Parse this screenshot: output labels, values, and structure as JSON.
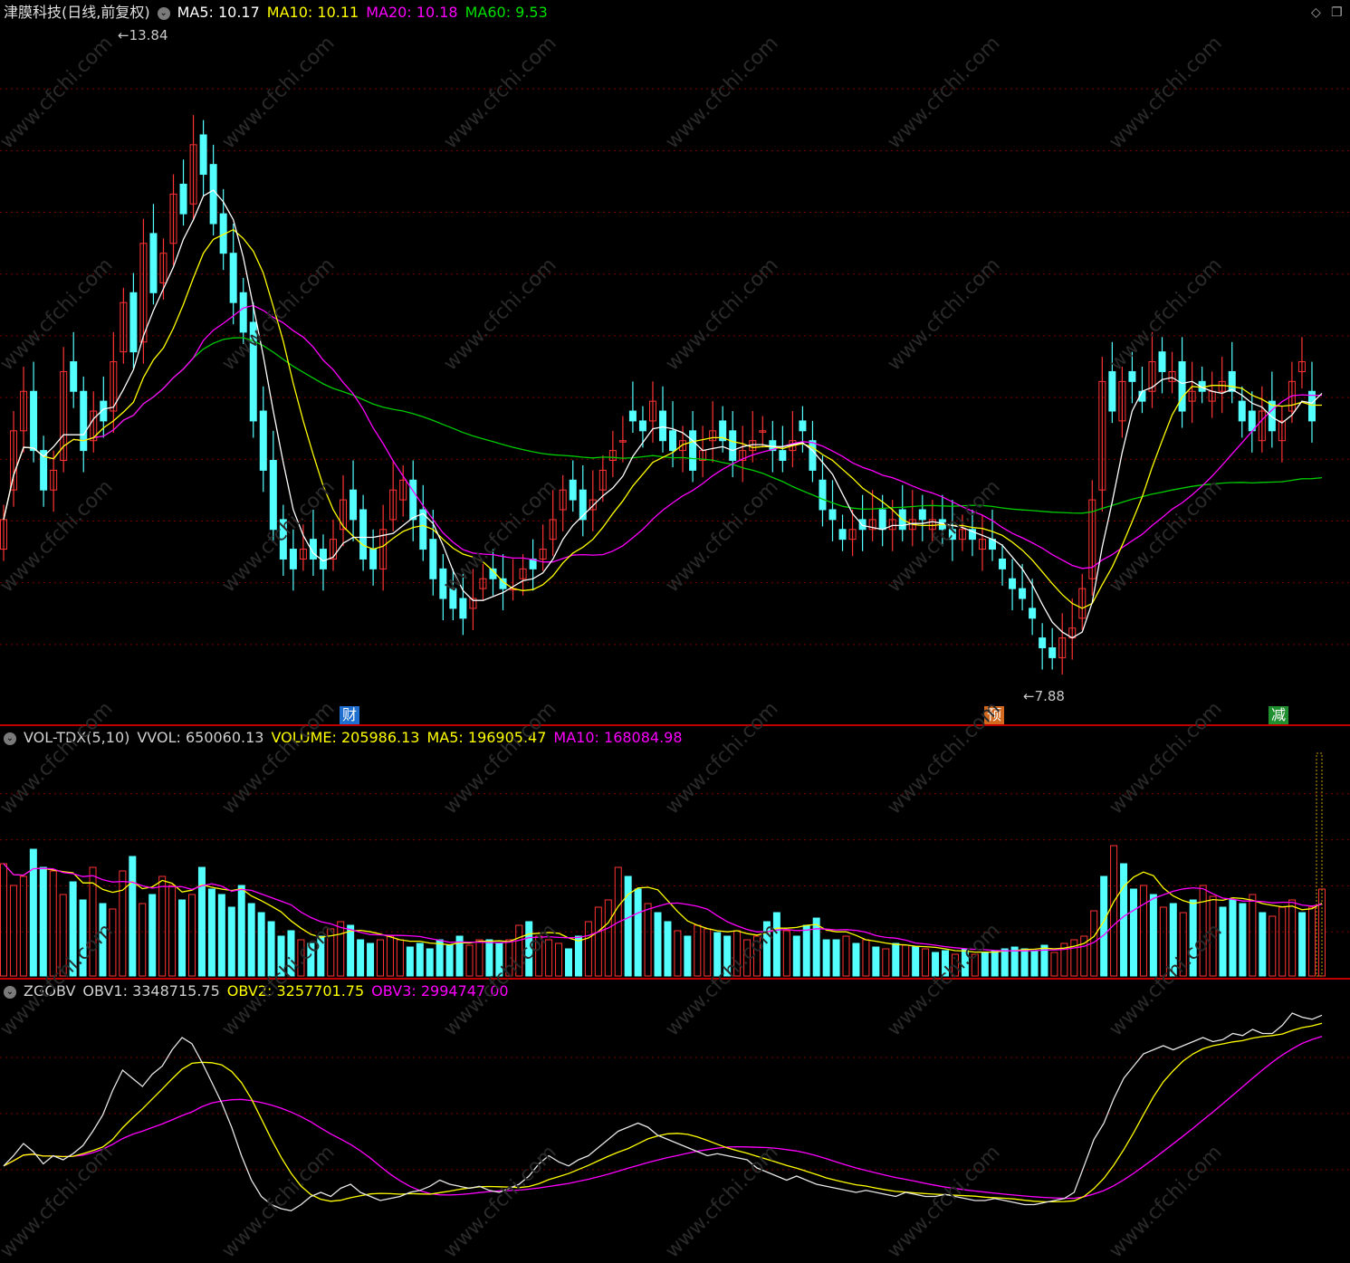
{
  "price": {
    "title": "津膜科技(日线,前复权)",
    "ma5": "MA5: 10.17",
    "ma10": "MA10: 10.11",
    "ma20": "MA20: 10.18",
    "ma60": "MA60: 9.53",
    "high_label": "13.84",
    "low_label": "7.88",
    "markers": [
      {
        "text": "财",
        "color": "#1e6fd0"
      },
      {
        "text": "预",
        "color": "#d2691e"
      },
      {
        "text": "减",
        "color": "#1f8f2f"
      }
    ]
  },
  "volume": {
    "name": "VOL-TDX(5,10)",
    "vvol": "VVOL: 650060.13",
    "volume": "VOLUME: 205986.13",
    "ma5": "MA5: 196905.47",
    "ma10": "MA10: 168084.98"
  },
  "obv": {
    "name": "ZGOBV",
    "obv1": "OBV1: 3348715.75",
    "obv2": "OBV2: 3257701.75",
    "obv3": "OBV3: 2994747.00"
  },
  "watermark": "www.cfchi.com",
  "colors": {
    "up": "#ff3333",
    "down": "#54ffff",
    "ma5": "#ffffff",
    "ma10": "#ffff00",
    "ma20": "#ff00ff",
    "ma60": "#00cc00",
    "grid": "#7a0000"
  },
  "chart_data": [
    {
      "type": "candlestick",
      "title": "津膜科技(日线,前复权)",
      "ylim": [
        7.5,
        14.2
      ],
      "annotations": [
        "13.84",
        "7.88"
      ],
      "close": [
        9.3,
        10.2,
        10.6,
        10.0,
        9.6,
        9.8,
        10.8,
        10.6,
        10.0,
        10.4,
        10.3,
        10.9,
        11.5,
        11.0,
        12.1,
        11.6,
        12.0,
        12.6,
        12.4,
        13.1,
        12.8,
        12.3,
        12.0,
        11.5,
        11.2,
        10.3,
        9.8,
        9.2,
        8.9,
        8.8,
        9.0,
        8.9,
        8.8,
        9.1,
        9.5,
        9.3,
        8.9,
        8.8,
        9.2,
        9.6,
        9.7,
        9.3,
        9.0,
        8.7,
        8.5,
        8.4,
        8.3,
        8.5,
        8.7,
        8.7,
        8.6,
        8.6,
        8.8,
        8.8,
        9.0,
        9.3,
        9.6,
        9.5,
        9.3,
        9.5,
        9.8,
        10.0,
        10.1,
        10.3,
        10.2,
        10.5,
        10.1,
        10.0,
        10.1,
        9.8,
        10.0,
        10.2,
        10.1,
        9.9,
        10.0,
        10.1,
        10.2,
        10.0,
        9.9,
        10.1,
        10.2,
        9.8,
        9.4,
        9.3,
        9.1,
        9.2,
        9.2,
        9.3,
        9.2,
        9.3,
        9.2,
        9.3,
        9.3,
        9.3,
        9.2,
        9.1,
        9.2,
        9.1,
        9.1,
        9.0,
        8.8,
        8.6,
        8.5,
        8.3,
        8.0,
        7.9,
        8.1,
        8.2,
        8.6,
        9.5,
        10.7,
        10.4,
        10.7,
        10.7,
        10.5,
        10.9,
        10.8,
        10.8,
        10.4,
        10.6,
        10.6,
        10.6,
        10.7,
        10.6,
        10.3,
        10.2,
        10.4,
        10.2,
        10.3,
        10.7,
        10.9,
        10.3,
        10.7
      ],
      "open": [
        9.0,
        9.6,
        10.2,
        10.6,
        10.0,
        9.6,
        9.9,
        10.9,
        10.6,
        10.1,
        10.5,
        10.4,
        11.0,
        11.6,
        11.1,
        12.2,
        11.7,
        12.1,
        12.7,
        12.5,
        13.2,
        12.9,
        12.4,
        12.0,
        11.6,
        11.3,
        10.4,
        9.9,
        9.3,
        9.0,
        8.9,
        9.1,
        9.0,
        8.9,
        9.2,
        9.6,
        9.4,
        9.0,
        8.8,
        9.3,
        9.5,
        9.7,
        9.4,
        9.1,
        8.8,
        8.6,
        8.5,
        8.4,
        8.6,
        8.8,
        8.7,
        8.6,
        8.7,
        8.9,
        8.9,
        9.1,
        9.4,
        9.7,
        9.6,
        9.4,
        9.6,
        9.9,
        10.1,
        10.4,
        10.3,
        10.3,
        10.4,
        10.2,
        10.0,
        10.2,
        9.9,
        10.1,
        10.3,
        10.2,
        9.9,
        10.0,
        10.2,
        10.1,
        10.0,
        10.0,
        10.3,
        10.1,
        9.7,
        9.4,
        9.2,
        9.1,
        9.3,
        9.2,
        9.4,
        9.2,
        9.4,
        9.2,
        9.4,
        9.2,
        9.3,
        9.2,
        9.1,
        9.2,
        9.0,
        9.1,
        8.9,
        8.7,
        8.6,
        8.4,
        8.1,
        8.0,
        7.9,
        8.1,
        8.3,
        8.7,
        9.6,
        10.8,
        10.3,
        10.8,
        10.6,
        10.6,
        11.0,
        10.7,
        10.9,
        10.5,
        10.7,
        10.5,
        10.6,
        10.8,
        10.5,
        10.4,
        10.1,
        10.5,
        10.1,
        10.4,
        10.8,
        10.6
      ]
    },
    {
      "type": "bar",
      "title": "VOL-TDX(5,10)",
      "series": [
        {
          "name": "VOLUME"
        },
        {
          "name": "MA5"
        },
        {
          "name": "MA10"
        }
      ],
      "values": [
        0.47,
        0.49,
        0.5,
        0.48,
        0.47,
        0.62,
        0.64,
        0.55,
        0.53,
        0.56,
        0.59,
        0.53,
        0.67,
        0.66,
        0.62,
        0.58,
        0.63,
        0.66,
        0.64,
        0.62,
        0.59,
        0.54,
        0.51,
        0.49,
        0.47,
        0.44,
        0.42,
        0.41,
        0.39,
        0.37,
        0.35,
        0.34,
        0.34,
        0.35,
        0.36,
        0.35,
        0.34,
        0.33,
        0.32,
        0.31,
        0.31,
        0.3,
        0.3,
        0.31,
        0.31,
        0.31,
        0.3,
        0.3,
        0.3,
        0.3,
        0.3,
        0.31,
        0.31,
        0.31,
        0.32,
        0.33,
        0.34,
        0.35,
        0.36,
        0.37,
        0.38,
        0.38,
        0.39,
        0.4,
        0.41,
        0.42,
        0.42,
        0.43,
        0.44,
        0.45,
        0.45,
        0.46,
        0.47,
        0.47,
        0.48,
        0.48,
        0.49,
        0.49,
        0.49,
        0.49,
        0.48,
        0.47,
        0.46,
        0.45,
        0.44,
        0.43,
        0.42,
        0.41,
        0.41,
        0.4,
        0.39,
        0.38,
        0.37,
        0.37,
        0.36,
        0.36,
        0.35,
        0.35,
        0.35,
        0.34,
        0.34,
        0.34,
        0.34,
        0.34,
        0.34,
        0.35,
        0.35,
        0.36,
        0.37,
        0.39,
        0.42,
        0.45,
        0.48,
        0.51,
        0.53,
        0.55,
        0.57,
        0.58,
        0.59,
        0.59,
        0.6,
        0.6,
        0.6,
        0.6,
        0.6,
        0.6,
        0.59,
        0.59,
        0.59,
        0.58,
        0.58,
        0.57,
        0.57,
        0.58
      ],
      "volume": [
        0.62,
        0.5,
        0.55,
        0.7,
        0.6,
        0.58,
        0.45,
        0.52,
        0.42,
        0.6,
        0.4,
        0.37,
        0.58,
        0.66,
        0.4,
        0.45,
        0.55,
        0.5,
        0.42,
        0.45,
        0.6,
        0.48,
        0.45,
        0.38,
        0.5,
        0.4,
        0.35,
        0.3,
        0.22,
        0.25,
        0.2,
        0.18,
        0.22,
        0.26,
        0.3,
        0.28,
        0.2,
        0.18,
        0.2,
        0.22,
        0.2,
        0.16,
        0.18,
        0.15,
        0.2,
        0.17,
        0.22,
        0.17,
        0.2,
        0.2,
        0.18,
        0.2,
        0.28,
        0.3,
        0.22,
        0.2,
        0.18,
        0.15,
        0.22,
        0.3,
        0.38,
        0.42,
        0.6,
        0.55,
        0.48,
        0.4,
        0.35,
        0.3,
        0.25,
        0.22,
        0.28,
        0.26,
        0.24,
        0.22,
        0.25,
        0.2,
        0.22,
        0.3,
        0.35,
        0.25,
        0.22,
        0.28,
        0.32,
        0.2,
        0.2,
        0.22,
        0.18,
        0.2,
        0.16,
        0.15,
        0.18,
        0.17,
        0.16,
        0.15,
        0.13,
        0.14,
        0.12,
        0.15,
        0.12,
        0.13,
        0.14,
        0.15,
        0.16,
        0.15,
        0.14,
        0.17,
        0.13,
        0.18,
        0.2,
        0.22,
        0.36,
        0.55,
        0.72,
        0.62,
        0.48,
        0.5,
        0.45,
        0.38,
        0.4,
        0.35,
        0.42,
        0.5,
        0.44,
        0.38,
        0.42,
        0.4,
        0.45,
        0.35,
        0.33,
        0.38,
        0.42,
        0.35,
        0.38,
        0.48
      ]
    },
    {
      "type": "line",
      "title": "ZGOBV",
      "series": [
        {
          "name": "OBV1"
        },
        {
          "name": "OBV2"
        },
        {
          "name": "OBV3"
        }
      ],
      "obv1": [
        0.25,
        0.3,
        0.36,
        0.32,
        0.26,
        0.3,
        0.28,
        0.31,
        0.35,
        0.42,
        0.5,
        0.62,
        0.72,
        0.68,
        0.64,
        0.7,
        0.74,
        0.82,
        0.88,
        0.85,
        0.76,
        0.66,
        0.56,
        0.44,
        0.3,
        0.18,
        0.1,
        0.06,
        0.04,
        0.03,
        0.06,
        0.1,
        0.12,
        0.1,
        0.14,
        0.16,
        0.12,
        0.1,
        0.08,
        0.09,
        0.1,
        0.12,
        0.13,
        0.15,
        0.18,
        0.16,
        0.15,
        0.14,
        0.15,
        0.13,
        0.12,
        0.14,
        0.16,
        0.2,
        0.26,
        0.3,
        0.27,
        0.25,
        0.28,
        0.3,
        0.34,
        0.38,
        0.42,
        0.44,
        0.46,
        0.44,
        0.4,
        0.38,
        0.36,
        0.34,
        0.32,
        0.3,
        0.31,
        0.3,
        0.29,
        0.28,
        0.24,
        0.22,
        0.2,
        0.18,
        0.2,
        0.18,
        0.16,
        0.15,
        0.14,
        0.13,
        0.12,
        0.13,
        0.12,
        0.11,
        0.1,
        0.12,
        0.11,
        0.1,
        0.1,
        0.11,
        0.1,
        0.09,
        0.08,
        0.08,
        0.09,
        0.08,
        0.07,
        0.06,
        0.06,
        0.07,
        0.08,
        0.09,
        0.12,
        0.25,
        0.38,
        0.46,
        0.58,
        0.68,
        0.74,
        0.8,
        0.82,
        0.84,
        0.82,
        0.84,
        0.86,
        0.88,
        0.86,
        0.87,
        0.9,
        0.89,
        0.92,
        0.9,
        0.9,
        0.94,
        1.0,
        0.98,
        0.97,
        0.99
      ]
    }
  ]
}
